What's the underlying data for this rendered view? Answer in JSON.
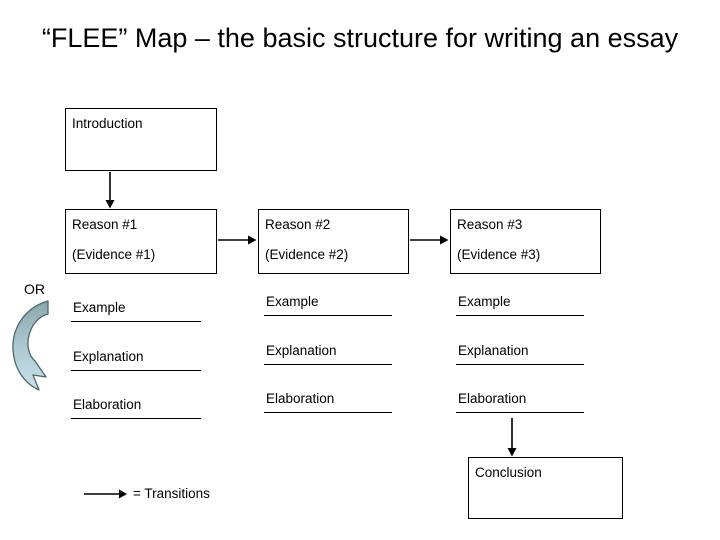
{
  "slide": {
    "title": "“FLEE” Map – the basic structure for writing an essay",
    "background_color": "#ffffff",
    "text_color": "#000000",
    "line_color": "#000000"
  },
  "intro": {
    "label": "Introduction"
  },
  "reasons": [
    {
      "title": "Reason #1",
      "evidence": "(Evidence #1)"
    },
    {
      "title": "Reason #2",
      "evidence": "(Evidence #2)"
    },
    {
      "title": "Reason #3",
      "evidence": "(Evidence #3)"
    }
  ],
  "columns": [
    {
      "items": [
        {
          "label": "Example"
        },
        {
          "label": "Explanation"
        },
        {
          "label": "Elaboration"
        }
      ]
    },
    {
      "items": [
        {
          "label": "Example"
        },
        {
          "label": "Explanation"
        },
        {
          "label": "Elaboration"
        }
      ]
    },
    {
      "items": [
        {
          "label": "Example"
        },
        {
          "label": "Explanation"
        },
        {
          "label": "Elaboration"
        }
      ]
    }
  ],
  "or_marker": {
    "label": "OR",
    "arrow_icon": "curved-arrow-icon",
    "gradient_top_color": "#8FA8AC",
    "gradient_bottom_color": "#C5E0E8",
    "outline_color": "#4A6165"
  },
  "conclusion": {
    "label": "Conclusion"
  },
  "legend": {
    "arrow_icon": "right-arrow-icon",
    "text": "= Transitions"
  }
}
